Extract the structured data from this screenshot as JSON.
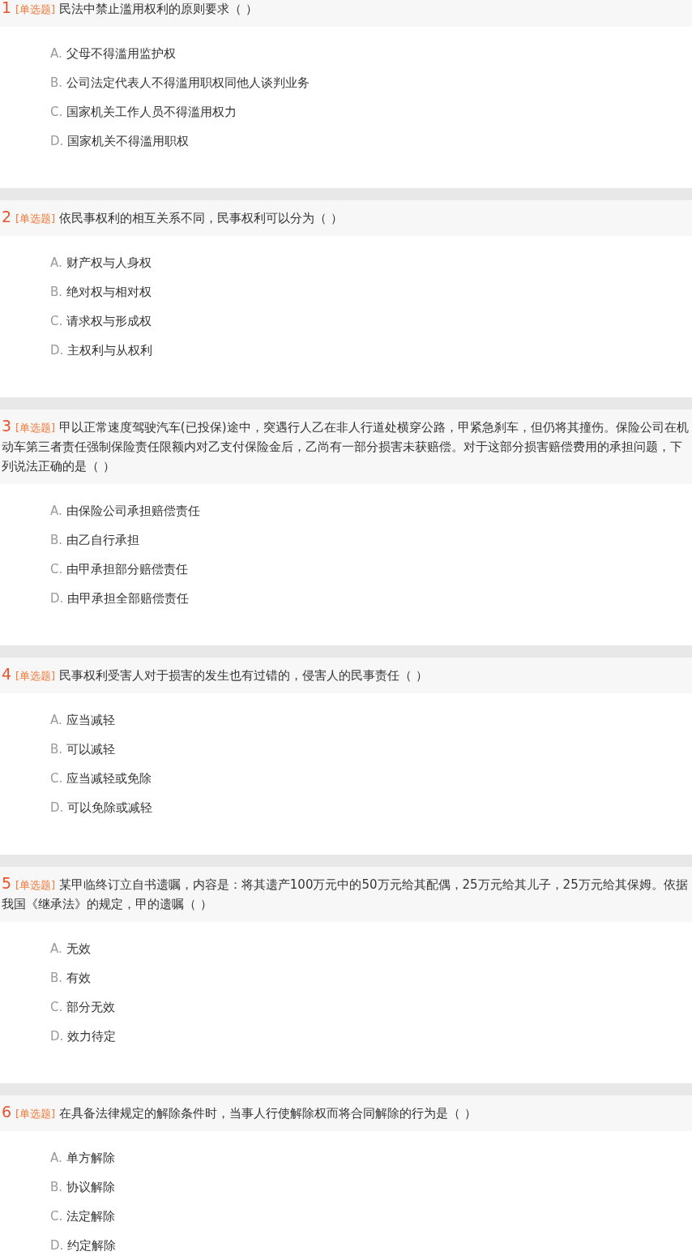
{
  "questions": [
    {
      "number": "1",
      "tag": "[单选题]",
      "text": "民法中禁止滥用权利的原则要求（ ）",
      "options": [
        {
          "letter": "A.",
          "text": "父母不得滥用监护权"
        },
        {
          "letter": "B.",
          "text": "公司法定代表人不得滥用职权同他人谈判业务"
        },
        {
          "letter": "C.",
          "text": "国家机关工作人员不得滥用权力"
        },
        {
          "letter": "D.",
          "text": "国家机关不得滥用职权"
        }
      ]
    },
    {
      "number": "2",
      "tag": "[单选题]",
      "text": "依民事权利的相互关系不同，民事权利可以分为（ ）",
      "options": [
        {
          "letter": "A.",
          "text": "财产权与人身权"
        },
        {
          "letter": "B.",
          "text": "绝对权与相对权"
        },
        {
          "letter": "C.",
          "text": "请求权与形成权"
        },
        {
          "letter": "D.",
          "text": "主权利与从权利"
        }
      ]
    },
    {
      "number": "3",
      "tag": "[单选题]",
      "text": "甲以正常速度驾驶汽车(已投保)途中，突遇行人乙在非人行道处横穿公路，甲紧急刹车，但仍将其撞伤。保险公司在机动车第三者责任强制保险责任限额内对乙支付保险金后，乙尚有一部分损害未获赔偿。对于这部分损害赔偿费用的承担问题，下列说法正确的是（ ）",
      "options": [
        {
          "letter": "A.",
          "text": "由保险公司承担赔偿责任"
        },
        {
          "letter": "B.",
          "text": "由乙自行承担"
        },
        {
          "letter": "C.",
          "text": "由甲承担部分赔偿责任"
        },
        {
          "letter": "D.",
          "text": "由甲承担全部赔偿责任"
        }
      ]
    },
    {
      "number": "4",
      "tag": "[单选题]",
      "text": "民事权利受害人对于损害的发生也有过错的，侵害人的民事责任（ ）",
      "options": [
        {
          "letter": "A.",
          "text": "应当减轻"
        },
        {
          "letter": "B.",
          "text": "可以减轻"
        },
        {
          "letter": "C.",
          "text": "应当减轻或免除"
        },
        {
          "letter": "D.",
          "text": "可以免除或减轻"
        }
      ]
    },
    {
      "number": "5",
      "tag": "[单选题]",
      "text": "某甲临终订立自书遗嘱，内容是：将其遗产100万元中的50万元给其配偶，25万元给其儿子，25万元给其保姆。依据我国《继承法》的规定，甲的遗嘱（ ）",
      "options": [
        {
          "letter": "A.",
          "text": "无效"
        },
        {
          "letter": "B.",
          "text": "有效"
        },
        {
          "letter": "C.",
          "text": "部分无效"
        },
        {
          "letter": "D.",
          "text": "效力待定"
        }
      ]
    },
    {
      "number": "6",
      "tag": "[单选题]",
      "text": "在具备法律规定的解除条件时，当事人行使解除权而将合同解除的行为是（ ）",
      "options": [
        {
          "letter": "A.",
          "text": "单方解除"
        },
        {
          "letter": "B.",
          "text": "协议解除"
        },
        {
          "letter": "C.",
          "text": "法定解除"
        },
        {
          "letter": "D.",
          "text": "约定解除"
        }
      ]
    }
  ]
}
